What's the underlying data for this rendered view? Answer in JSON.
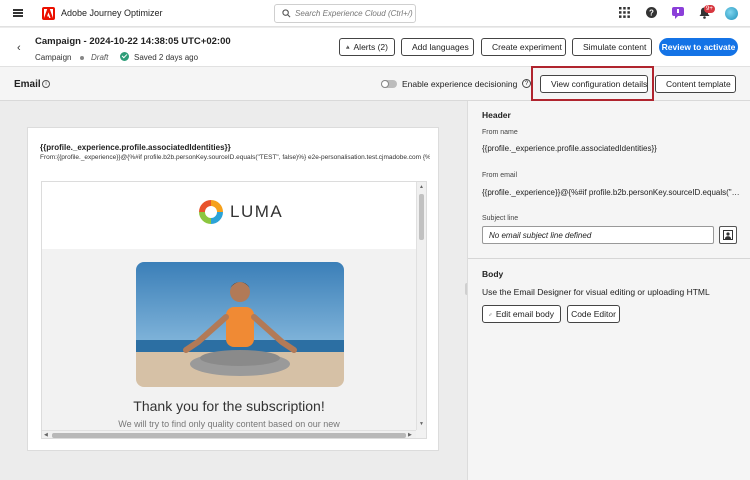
{
  "topbar": {
    "app_name": "Adobe Journey Optimizer",
    "search_placeholder": "Search Experience Cloud (Ctrl+/)",
    "notification_count": "9+"
  },
  "campaign": {
    "title": "Campaign - 2024-10-22 14:38:05 UTC+02:00",
    "type": "Campaign",
    "status": "Draft",
    "saved": "Saved 2 days ago",
    "buttons": {
      "alerts": "Alerts (2)",
      "languages": "Add languages",
      "experiment": "Create experiment",
      "simulate": "Simulate content",
      "review": "Review to activate"
    }
  },
  "email_bar": {
    "label": "Email",
    "decisioning": "Enable experience decisioning",
    "config": "View configuration details",
    "template": "Content template"
  },
  "preview": {
    "from_name": "{{profile._experience.profile.associatedIdentities}}",
    "from_email": "From:{{profile._experience}}@{%#if profile.b2b.personKey.sourceID.equals(\"TEST\", false)%} e2e-personalisation.test.cjmadobe.com {%/if%}",
    "brand": "LUMA",
    "headline": "Thank you for the subscription!",
    "subtext": "We will try to find only quality content based on our new"
  },
  "panel": {
    "header_title": "Header",
    "from_name_label": "From name",
    "from_name_value": "{{profile._experience.profile.associatedIdentities}}",
    "from_email_label": "From email",
    "from_email_value": "{{profile._experience}}@{%#if profile.b2b.personKey.sourceID.equals(\"TEST\", f...",
    "subject_label": "Subject line",
    "subject_placeholder": "No email subject line defined",
    "body_title": "Body",
    "body_desc": "Use the Email Designer for visual editing or uploading HTML",
    "edit_body": "Edit email body",
    "code_editor": "Code Editor"
  },
  "colors": {
    "accent": "#1473e6",
    "adobe_red": "#eb1000",
    "saved_green": "#2d9d78",
    "highlight": "#b0242e"
  }
}
